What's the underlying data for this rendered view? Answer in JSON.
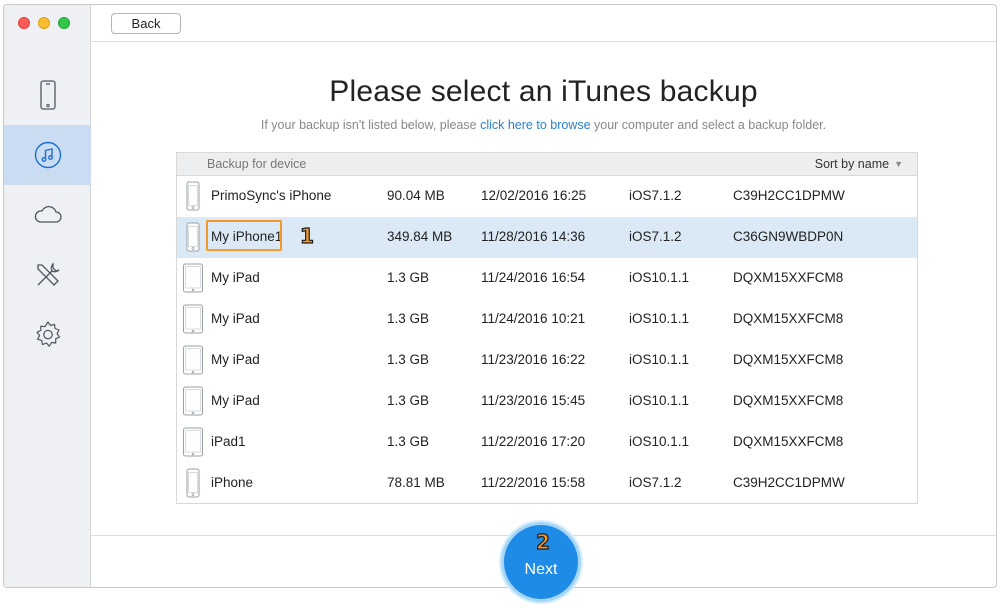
{
  "window": {
    "controls": [
      "close",
      "minimize",
      "maximize"
    ]
  },
  "sidebar": {
    "items": [
      {
        "icon": "iphone-icon",
        "active": false
      },
      {
        "icon": "itunes-music-icon",
        "active": true
      },
      {
        "icon": "icloud-icon",
        "active": false
      },
      {
        "icon": "tools-icon",
        "active": false
      },
      {
        "icon": "settings-gear-icon",
        "active": false
      }
    ]
  },
  "toolbar": {
    "back_label": "Back"
  },
  "main": {
    "title": "Please select an iTunes backup",
    "subtitle_before": "If your backup isn't listed below, please ",
    "subtitle_link": "click here to browse",
    "subtitle_after": " your computer and select a backup folder."
  },
  "table": {
    "header_device": "Backup for device",
    "sort_label": "Sort by name",
    "rows": [
      {
        "name": "PrimoSync's iPhone",
        "size": "90.04 MB",
        "date": "12/02/2016 16:25",
        "ios": "iOS7.1.2",
        "serial": "C39H2CC1DPMW",
        "device": "iphone",
        "selected": false
      },
      {
        "name": "My iPhone1",
        "size": "349.84 MB",
        "date": "11/28/2016 14:36",
        "ios": "iOS7.1.2",
        "serial": "C36GN9WBDP0N",
        "device": "iphone",
        "selected": true
      },
      {
        "name": "My iPad",
        "size": "1.3 GB",
        "date": "11/24/2016 16:54",
        "ios": "iOS10.1.1",
        "serial": "DQXM15XXFCM8",
        "device": "ipad",
        "selected": false
      },
      {
        "name": "My iPad",
        "size": "1.3 GB",
        "date": "11/24/2016 10:21",
        "ios": "iOS10.1.1",
        "serial": "DQXM15XXFCM8",
        "device": "ipad",
        "selected": false
      },
      {
        "name": "My iPad",
        "size": "1.3 GB",
        "date": "11/23/2016 16:22",
        "ios": "iOS10.1.1",
        "serial": "DQXM15XXFCM8",
        "device": "ipad",
        "selected": false
      },
      {
        "name": "My iPad",
        "size": "1.3 GB",
        "date": "11/23/2016 15:45",
        "ios": "iOS10.1.1",
        "serial": "DQXM15XXFCM8",
        "device": "ipad",
        "selected": false
      },
      {
        "name": "iPad1",
        "size": "1.3 GB",
        "date": "11/22/2016 17:20",
        "ios": "iOS10.1.1",
        "serial": "DQXM15XXFCM8",
        "device": "ipad",
        "selected": false
      },
      {
        "name": "iPhone",
        "size": "78.81 MB",
        "date": "11/22/2016 15:58",
        "ios": "iOS7.1.2",
        "serial": "C39H2CC1DPMW",
        "device": "iphone",
        "selected": false
      }
    ]
  },
  "annotations": {
    "step1": "1",
    "step2": "2",
    "highlight_color": "#f39a2d"
  },
  "footer": {
    "next_label": "Next"
  },
  "colors": {
    "accent": "#1e8ce6",
    "selected_row": "#dbe9f7",
    "link": "#2b7fd0"
  }
}
